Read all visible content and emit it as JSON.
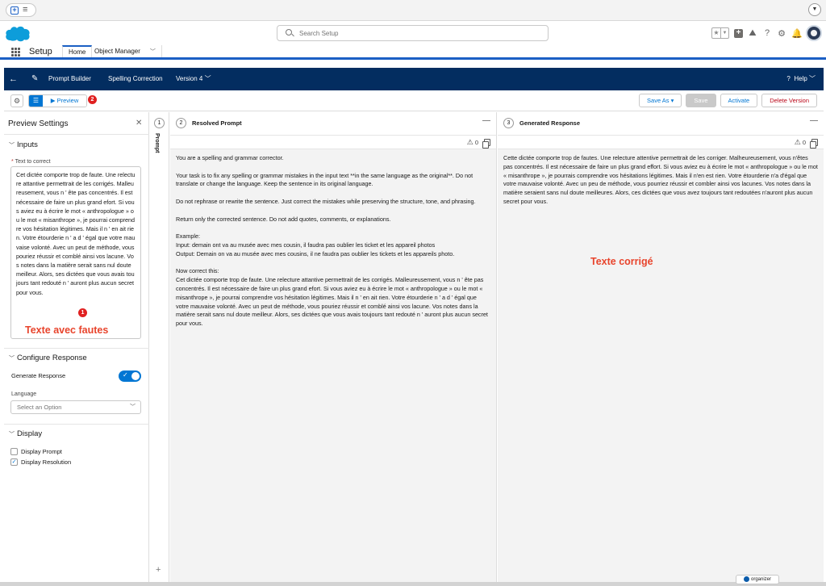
{
  "global": {
    "search_placeholder": "Search Setup"
  },
  "setup_nav": {
    "title": "Setup",
    "tabs": [
      {
        "label": "Home"
      },
      {
        "label": "Object Manager"
      }
    ]
  },
  "builder_bar": {
    "app": "Prompt Builder",
    "template_name": "Spelling Correction",
    "version": "Version 4",
    "help": "Help"
  },
  "toolbar": {
    "preview_label": "Preview",
    "badge": "2",
    "buttons": {
      "save_as": "Save As",
      "save": "Save",
      "activate": "Activate",
      "delete_version": "Delete Version"
    }
  },
  "preview_settings": {
    "title": "Preview Settings",
    "inputs_section": "Inputs",
    "text_label_required": "*",
    "text_label": "Text to correct",
    "text_value": "Cet dictée comporte trop de faute. Une relecture attantive permettrait de les corrigés. Malleureusement, vous n ' ête pas concentrés. Il est nécessaire de faire un plus grand efort. Si vous aviez eu à écrire le mot « anthropologue » ou le mot « misanthrope », je pourrai comprendre vos hésitation légitimes. Mais il n ' en ait rien. Votre étourderie n ' a d ' égal que votre mauvaise volonté. Avec un peut de méthode, vous pouriez réussir et comblé ainsi vos lacune. Vos notes dans la matière serait sans nul doute meilleur. Alors, ses dictées que vous avais toujours tant redouté n ' auront plus aucun secret pour vous.",
    "annotation_badge": "1",
    "annotation_text": "Texte avec fautes",
    "configure_section": "Configure Response",
    "generate_label": "Generate Response",
    "language_label": "Language",
    "language_placeholder": "Select an Option",
    "display_section": "Display",
    "display_prompt": "Display Prompt",
    "display_resolution": "Display Resolution"
  },
  "rail": {
    "step": "1",
    "label": "Prompt"
  },
  "resolved": {
    "step": "2",
    "title": "Resolved Prompt",
    "warnings": "0",
    "paragraphs": [
      "You are a spelling and grammar corrector.",
      "Your task is to fix any spelling or grammar mistakes in the input text **in the same language as the original**. Do not translate or change the language. Keep the sentence in its original language.",
      "Do not rephrase or rewrite the sentence. Just correct the mistakes while preserving the structure, tone, and phrasing.",
      "Return only the corrected sentence. Do not add quotes, comments, or explanations."
    ],
    "example_lines": [
      "Example:",
      "Input: demain ont va au musée avec mes cousin, il faudra pas oublier les ticket et les appareil photos",
      "Output: Demain on va au musée avec mes cousins, il ne faudra pas oublier les tickets et les appareils photo."
    ],
    "now_correct": "Now correct this:",
    "input_text": "Cet dictée comporte trop de faute. Une relecture attantive permettrait de les corrigés. Malleureusement, vous n ' ête pas concentrés. Il est nécessaire de faire un plus grand efort. Si vous aviez eu à écrire le mot « anthropologue » ou le mot « misanthrope », je pourrai comprendre vos hésitation légitimes. Mais il n ' en ait rien. Votre étourderie n ' a d ' égal que votre mauvaise volonté. Avec un peut de méthode, vous pouriez réussir et comblé ainsi vos lacune. Vos notes dans la matière serait sans nul doute meilleur. Alors, ses dictées que vous avais toujours tant redouté n ' auront plus aucun secret pour vous."
  },
  "generated": {
    "step": "3",
    "title": "Generated Response",
    "warnings": "0",
    "text": "Cette dictée comporte trop de fautes. Une relecture attentive permettrait de les corriger. Malheureusement, vous n'êtes pas concentrés. Il est nécessaire de faire un plus grand effort. Si vous aviez eu à écrire le mot « anthropologue » ou le mot « misanthrope », je pourrais comprendre vos hésitations légitimes. Mais il n'en est rien. Votre étourderie n'a d'égal que votre mauvaise volonté. Avec un peu de méthode, vous pourriez réussir et combler ainsi vos lacunes. Vos notes dans la matière seraient sans nul doute meilleures. Alors, ces dictées que vous avez toujours tant redoutées n'auront plus aucun secret pour vous.",
    "annotation_text": "Texte corrigé"
  },
  "footer": {
    "organizer": "organizer"
  },
  "colors": {
    "brand_blue": "#0176d3",
    "builder_bar": "#032d60",
    "annotation_red": "#e8442c"
  }
}
